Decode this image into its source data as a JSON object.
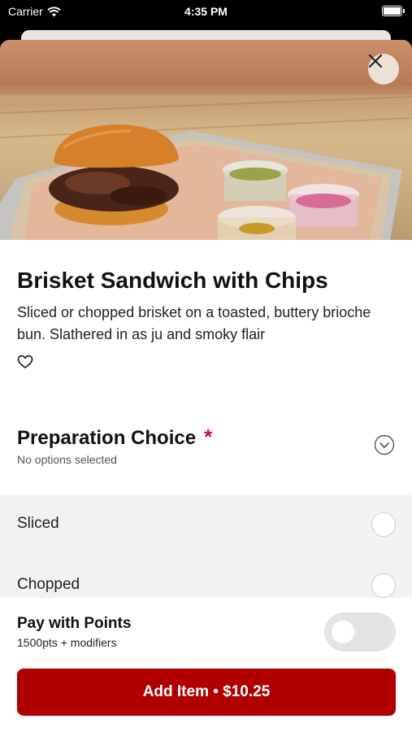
{
  "status_bar": {
    "carrier": "Carrier",
    "time": "4:35 PM"
  },
  "item": {
    "title": "Brisket Sandwich with Chips",
    "description": "Sliced or chopped brisket on a toasted, buttery brioche bun. Slathered in as ju and smoky flair",
    "favorite_icon": "heart-outline-icon"
  },
  "modifier_group": {
    "title": "Preparation Choice",
    "required_mark": "*",
    "subtitle": "No options selected",
    "options": [
      {
        "label": "Sliced"
      },
      {
        "label": "Chopped"
      }
    ]
  },
  "footer": {
    "pay_title": "Pay with Points",
    "pay_subtitle": "1500pts + modifiers",
    "pay_toggle_on": false,
    "add_button_label": "Add Item • $10.25"
  },
  "colors": {
    "accent": "#b10000",
    "required": "#c8102e"
  }
}
